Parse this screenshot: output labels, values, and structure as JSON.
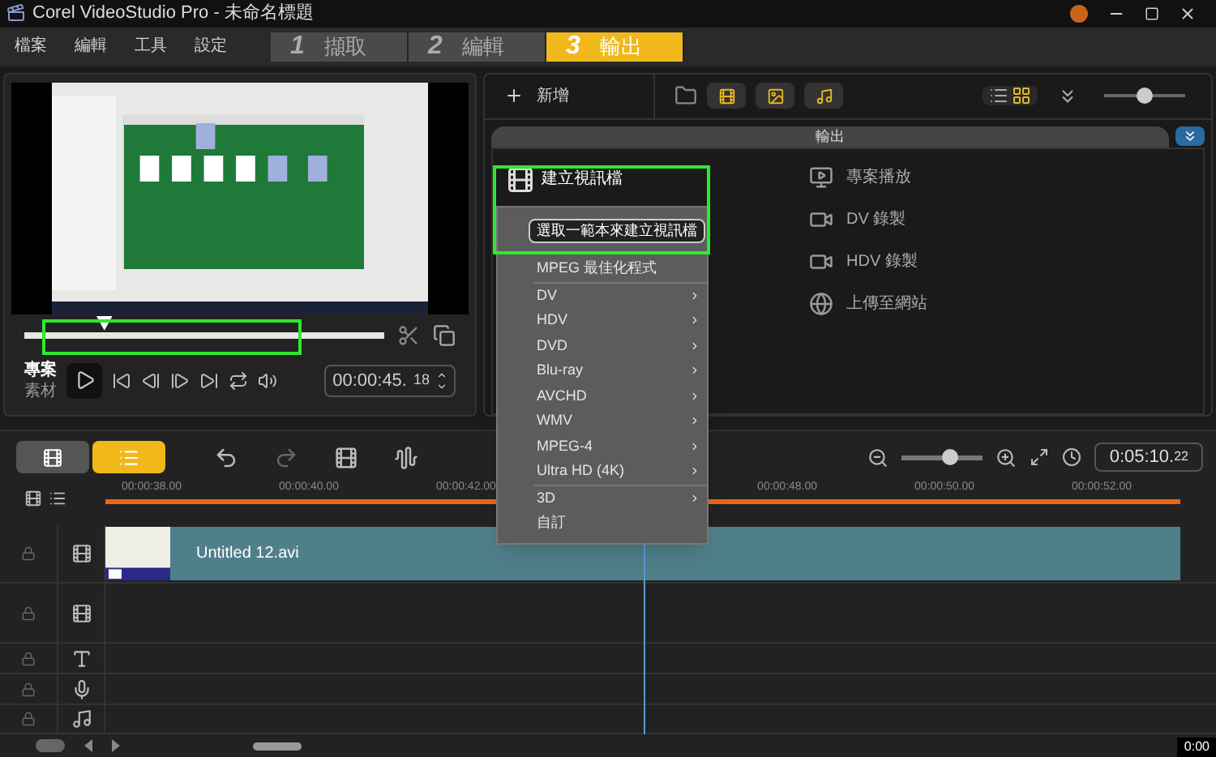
{
  "window": {
    "title": "Corel VideoStudio Pro - 未命名標題"
  },
  "menu": [
    "檔案",
    "編輯",
    "工具",
    "設定"
  ],
  "steps": [
    {
      "number": "1",
      "label": "擷取",
      "selected": false
    },
    {
      "number": "2",
      "label": "編輯",
      "selected": false
    },
    {
      "number": "3",
      "label": "輸出",
      "selected": true
    }
  ],
  "preview": {
    "mode_labels": [
      {
        "label": "專案",
        "selected": true
      },
      {
        "label": "素材",
        "selected": false
      }
    ],
    "scrubber": {
      "level": 0.2
    },
    "timecode": "00:00:45.",
    "frame": "18"
  },
  "library": {
    "add_label": "新增",
    "views": [
      {
        "kind": "list",
        "selected": false
      },
      {
        "kind": "grid",
        "selected": true
      }
    ],
    "size_slider": {
      "level": 0.5
    },
    "tab": "輸出",
    "options_left": [
      {
        "label": "建立視訊檔"
      }
    ],
    "options_right": [
      {
        "label": "專案播放",
        "kind": "play"
      },
      {
        "label": "DV 錄製",
        "kind": "camera"
      },
      {
        "label": "HDV 錄製",
        "kind": "camera"
      },
      {
        "label": "上傳至網站",
        "kind": "web"
      }
    ]
  },
  "context_menu": {
    "tooltip": "選取一範本來建立視訊檔",
    "items": [
      {
        "label": "MPEG 最佳化程式",
        "kind": "plain",
        "separator_after": true
      },
      {
        "label": "DV",
        "kind": "submenu",
        "separator_after": false
      },
      {
        "label": "HDV",
        "kind": "submenu",
        "separator_after": false
      },
      {
        "label": "DVD",
        "kind": "submenu",
        "separator_after": false
      },
      {
        "label": "Blu-ray",
        "kind": "submenu",
        "separator_after": false
      },
      {
        "label": "AVCHD",
        "kind": "submenu",
        "separator_after": false
      },
      {
        "label": "WMV",
        "kind": "submenu",
        "separator_after": false
      },
      {
        "label": "MPEG-4",
        "kind": "submenu",
        "separator_after": false
      },
      {
        "label": "Ultra HD (4K)",
        "kind": "submenu",
        "separator_after": true
      },
      {
        "label": "3D",
        "kind": "submenu",
        "separator_after": false
      },
      {
        "label": "自訂",
        "kind": "plain",
        "separator_after": false
      }
    ]
  },
  "timeline": {
    "views": [
      {
        "kind": "storyboard",
        "selected": false
      },
      {
        "kind": "timeline",
        "selected": true
      }
    ],
    "zoom_slider": {
      "level": 0.6
    },
    "duration": "0:05:10.",
    "duration_frames": "22",
    "ruler_left": [
      "00:00:38.00",
      "00:00:40.00",
      "00:00:42.00"
    ],
    "ruler_right": [
      "00:00:48.00",
      "00:00:50.00",
      "00:00:52.00"
    ],
    "clip": "Untitled 12.avi",
    "position": "0:00"
  }
}
